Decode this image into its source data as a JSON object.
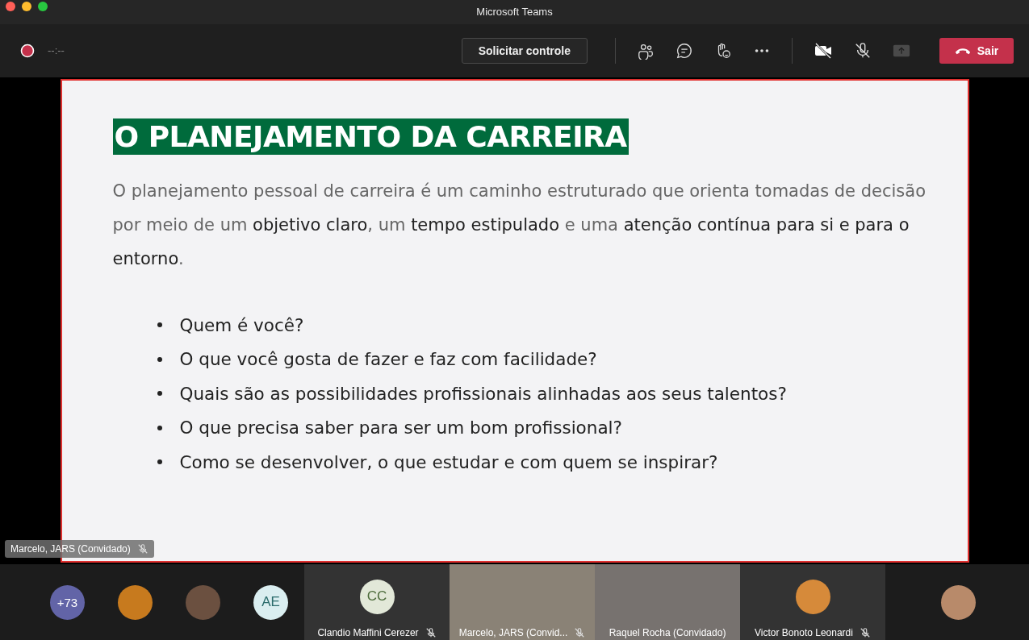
{
  "window": {
    "title": "Microsoft Teams"
  },
  "toolbar": {
    "recording": true,
    "timer": "--:--",
    "request_button": "Solicitar controle",
    "share_disabled": true,
    "leave_button": "Sair"
  },
  "slide": {
    "title": "O PLANEJAMENTO DA CARREIRA",
    "paragraph": "O planejamento pessoal de carreira é um caminho estruturado que orienta tomadas de decisão por meio de um **objetivo claro**, um **tempo estipulado** e uma **atenção contínua para si e para o entorno**.",
    "bullets": [
      "Quem é você?",
      "O que você gosta de fazer e faz com facilidade?",
      "Quais são as possibilidades profissionais alinhadas aos seus talentos?",
      "O que precisa saber para ser um bom profissional?",
      "Como se desenvolver, o que estudar e com quem se inspirar?"
    ]
  },
  "presenter_label": {
    "name": "Marcelo, JARS (Convidado)",
    "muted": true
  },
  "roster": [
    {
      "kind": "count",
      "text": "+73",
      "color": "#6264a7"
    },
    {
      "kind": "photo",
      "color": "#c77a1e"
    },
    {
      "kind": "photo",
      "color": "#6b5040"
    },
    {
      "kind": "initials",
      "text": "AE",
      "color": "#daeef0"
    }
  ],
  "tiles": [
    {
      "kind": "initials",
      "initials": "CC",
      "color": "#e2e8d8",
      "name": "Clandio Maffini Cerezer",
      "muted": true
    },
    {
      "kind": "video",
      "color": "#8a8276",
      "name": "Marcelo, JARS (Convid...",
      "muted": true
    },
    {
      "kind": "video",
      "color": "#77726f",
      "name": "Raquel Rocha (Convidado)",
      "muted": false
    },
    {
      "kind": "photo",
      "color": "#d68a3a",
      "name": "Victor Bonoto Leonardi",
      "muted": true
    }
  ],
  "self_view": {
    "kind": "photo",
    "color": "#b88a6a"
  }
}
